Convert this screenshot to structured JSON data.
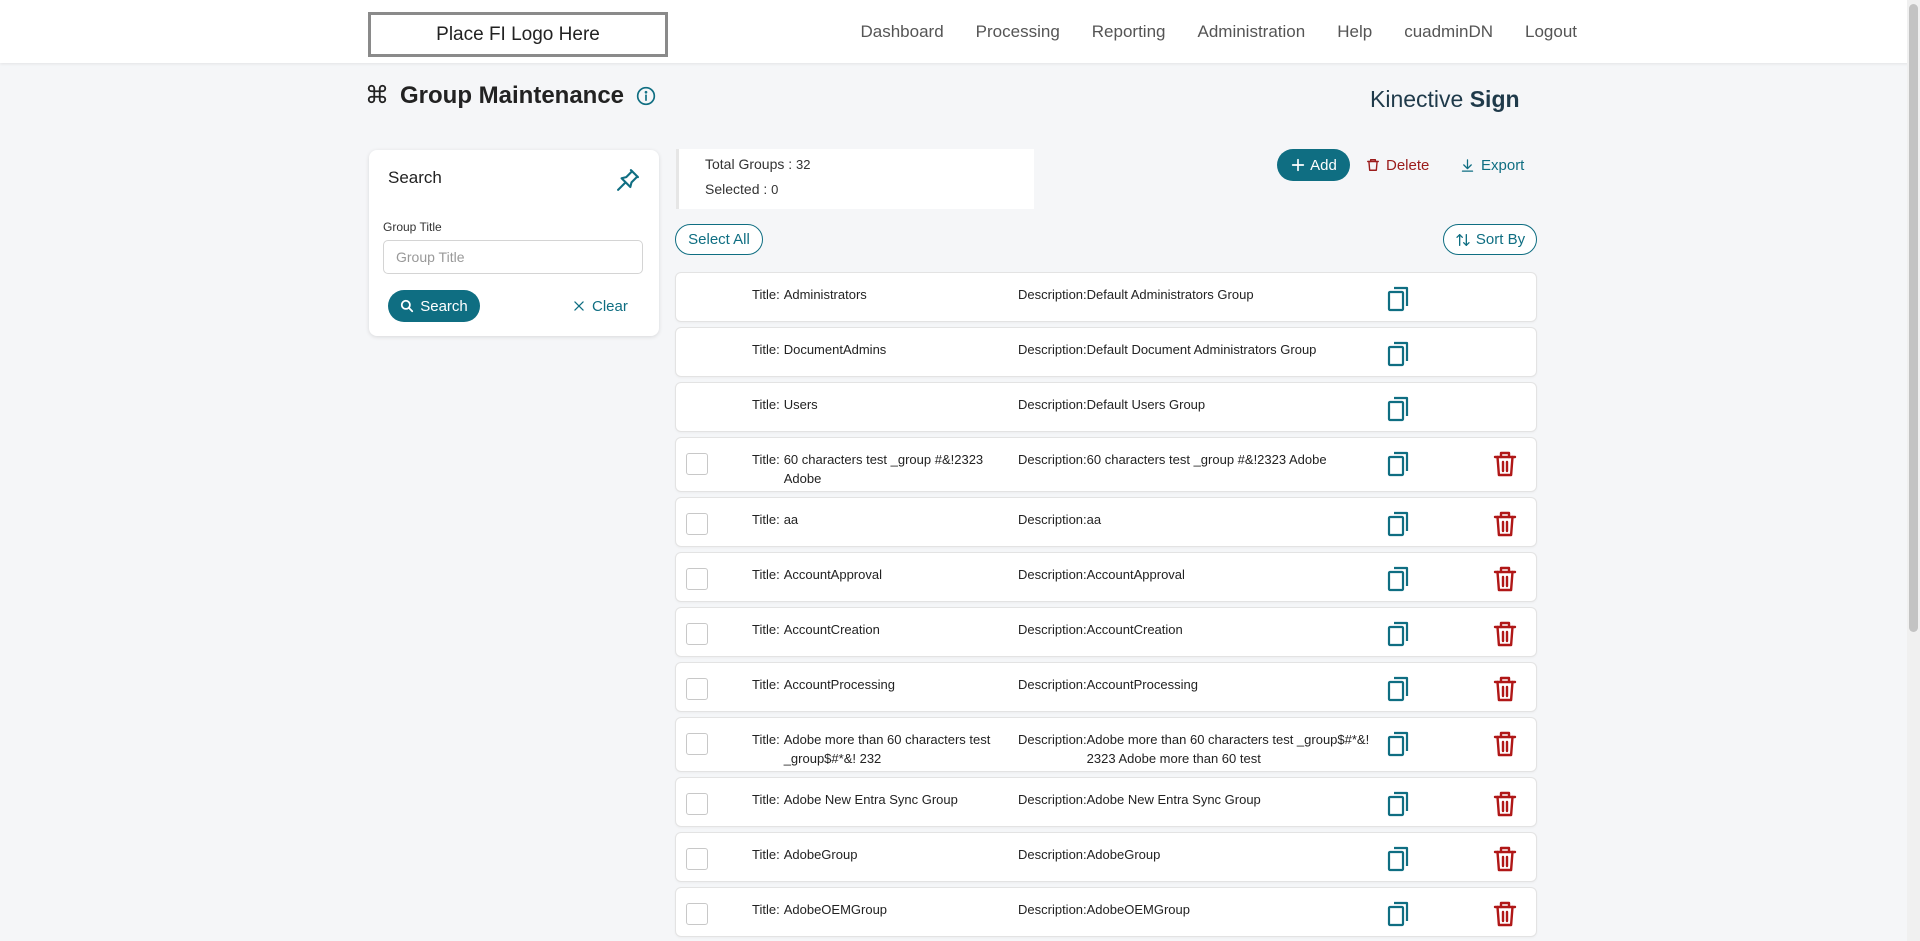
{
  "header": {
    "logo_text": "Place FI Logo Here",
    "nav": [
      "Dashboard",
      "Processing",
      "Reporting",
      "Administration",
      "Help",
      "cuadminDN",
      "Logout"
    ]
  },
  "page": {
    "title": "Group Maintenance",
    "brand_light": "Kinective ",
    "brand_bold": "Sign"
  },
  "search": {
    "title": "Search",
    "group_title_label": "Group Title",
    "group_title_placeholder": "Group Title",
    "group_title_value": "",
    "search_button": "Search",
    "clear_button": "Clear"
  },
  "summary": {
    "total_label": "Total Groups : ",
    "total_value": "32",
    "selected_label": "Selected : ",
    "selected_value": "0"
  },
  "toolbar": {
    "add": "Add",
    "delete": "Delete",
    "export": "Export",
    "select_all": "Select All",
    "sort_by": "Sort By"
  },
  "labels": {
    "title_prefix": "Title:",
    "description_prefix": "Description:"
  },
  "groups": [
    {
      "title": "Administrators",
      "description": "Default Administrators Group",
      "deletable": false
    },
    {
      "title": "DocumentAdmins",
      "description": "Default Document Administrators Group",
      "deletable": false
    },
    {
      "title": "Users",
      "description": "Default Users Group",
      "deletable": false
    },
    {
      "title": "60 characters test _group #&!2323 Adobe",
      "description": "60 characters test _group #&!2323 Adobe",
      "deletable": true
    },
    {
      "title": "aa",
      "description": "aa",
      "deletable": true
    },
    {
      "title": "AccountApproval",
      "description": "AccountApproval",
      "deletable": true
    },
    {
      "title": "AccountCreation",
      "description": "AccountCreation",
      "deletable": true
    },
    {
      "title": "AccountProcessing",
      "description": "AccountProcessing",
      "deletable": true
    },
    {
      "title": "Adobe more than 60 characters test _group$#*&! 232",
      "description": "Adobe more than 60 characters test _group$#*&! 2323 Adobe more than 60 test",
      "deletable": true
    },
    {
      "title": "Adobe New Entra Sync Group",
      "description": "Adobe New Entra Sync Group",
      "deletable": true
    },
    {
      "title": "AdobeGroup",
      "description": "AdobeGroup",
      "deletable": true
    },
    {
      "title": "AdobeOEMGroup",
      "description": "AdobeOEMGroup",
      "deletable": true
    }
  ],
  "colors": {
    "accent": "#0f6e82",
    "danger": "#9b1c1c",
    "background": "#f5f6f8"
  }
}
